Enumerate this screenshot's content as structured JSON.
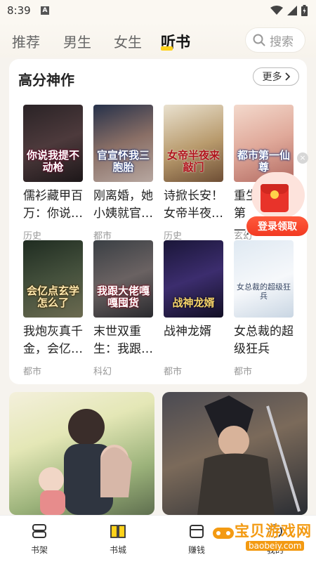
{
  "status_bar": {
    "time": "8:39",
    "indicator": "A"
  },
  "top_nav": {
    "tabs": [
      {
        "label": "推荐",
        "active": false
      },
      {
        "label": "男生",
        "active": false
      },
      {
        "label": "女生",
        "active": false
      },
      {
        "label": "听书",
        "active": true
      }
    ],
    "search_label": "搜索"
  },
  "section": {
    "title": "高分神作",
    "more_label": "更多",
    "books": [
      {
        "title": "儒衫藏甲百万：你说…",
        "category": "历史",
        "cover_text": "你说我提不动枪"
      },
      {
        "title": "刚离婚，她小姨就官…",
        "category": "都市",
        "cover_text": "官宣怀我三胞胎"
      },
      {
        "title": "诗掀长安！女帝半夜…",
        "category": "历史",
        "cover_text": "女帝半夜来敲门"
      },
      {
        "title": "重生第一…",
        "category": "玄幻",
        "cover_text": "都市第一仙尊"
      },
      {
        "title": "我炮灰真千金，会亿…",
        "category": "都市",
        "cover_text": "会亿点玄学怎么了"
      },
      {
        "title": "末世双重生：我跟…",
        "category": "科幻",
        "cover_text": "我跟大佬嘎嘎囤货"
      },
      {
        "title": "战神龙婿",
        "category": "都市",
        "cover_text": "战神龙婿"
      },
      {
        "title": "女总裁的超级狂兵",
        "category": "都市",
        "cover_text": "女总裁的超级狂兵"
      }
    ]
  },
  "floating_promo": {
    "button_label": "登录领取",
    "close_symbol": "×"
  },
  "bottom_nav": {
    "items": [
      {
        "label": "书架",
        "icon": "bookshelf-icon",
        "active": false
      },
      {
        "label": "书城",
        "icon": "open-book-icon",
        "active": true
      },
      {
        "label": "赚钱",
        "icon": "wallet-icon",
        "active": false
      },
      {
        "label": "我的",
        "icon": "profile-icon",
        "active": false
      }
    ]
  },
  "watermark": {
    "text": "宝贝游戏网",
    "url": "baobeiy.com"
  },
  "colors": {
    "accent_yellow": "#ffd21a",
    "promo_red": "#f23a22",
    "watermark_orange": "#f39a12"
  }
}
